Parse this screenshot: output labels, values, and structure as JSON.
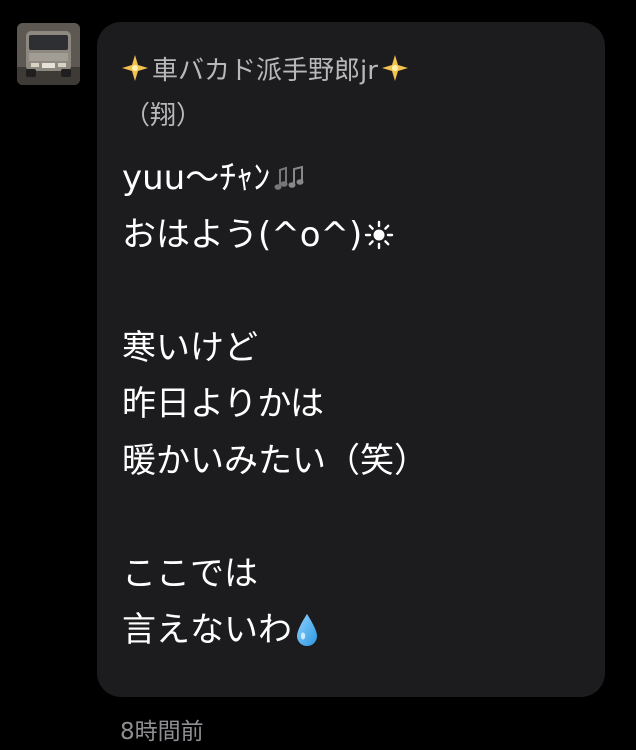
{
  "sender": {
    "name": "車バカド派手野郎jr",
    "sub": "（翔）",
    "avatar_icon": "van-photo-avatar",
    "decoration_icon": "sparkle-icon"
  },
  "message": {
    "line1": "yuu〜ﾁｬﾝ",
    "line1_icon": "music-notes-icon",
    "line2": "おはよう(^o^)",
    "line2_icon": "sun-icon",
    "line3": "寒いけど",
    "line4": "昨日よりかは",
    "line5": "暖かいみたい（笑）",
    "line6": "ここでは",
    "line7": "言えないわ",
    "line7_icon": "droplet-icon"
  },
  "timestamp": "8時間前",
  "colors": {
    "background": "#000000",
    "bubble": "#1c1c1e",
    "message_text": "#ffffff",
    "sender_text": "#b8b8ba",
    "timestamp_text": "#8e8e93",
    "droplet": "#4fb3f0",
    "sparkle": "#f2c14e"
  }
}
